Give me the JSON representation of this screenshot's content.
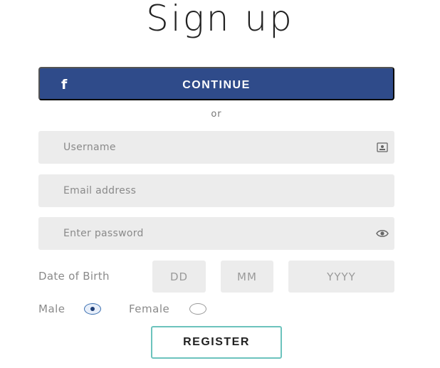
{
  "title": "Sign up",
  "facebook": {
    "icon_name": "facebook-icon",
    "icon_glyph": "f",
    "label": "CONTINUE",
    "color": "#2f4b8a"
  },
  "divider": "or",
  "fields": {
    "username": {
      "placeholder": "Username",
      "value": "",
      "icon_name": "id-card-icon"
    },
    "email": {
      "placeholder": "Email address",
      "value": ""
    },
    "password": {
      "placeholder": "Enter password",
      "value": "",
      "icon_name": "eye-icon"
    }
  },
  "dob": {
    "label": "Date of Birth",
    "day_placeholder": "DD",
    "month_placeholder": "MM",
    "year_placeholder": "YYYY"
  },
  "gender": {
    "options": [
      {
        "label": "Male",
        "selected": true
      },
      {
        "label": "Female",
        "selected": false
      }
    ],
    "accent": "#3a6fb0"
  },
  "register": {
    "label": "REGISTER",
    "border_color": "#6cc3bd"
  }
}
